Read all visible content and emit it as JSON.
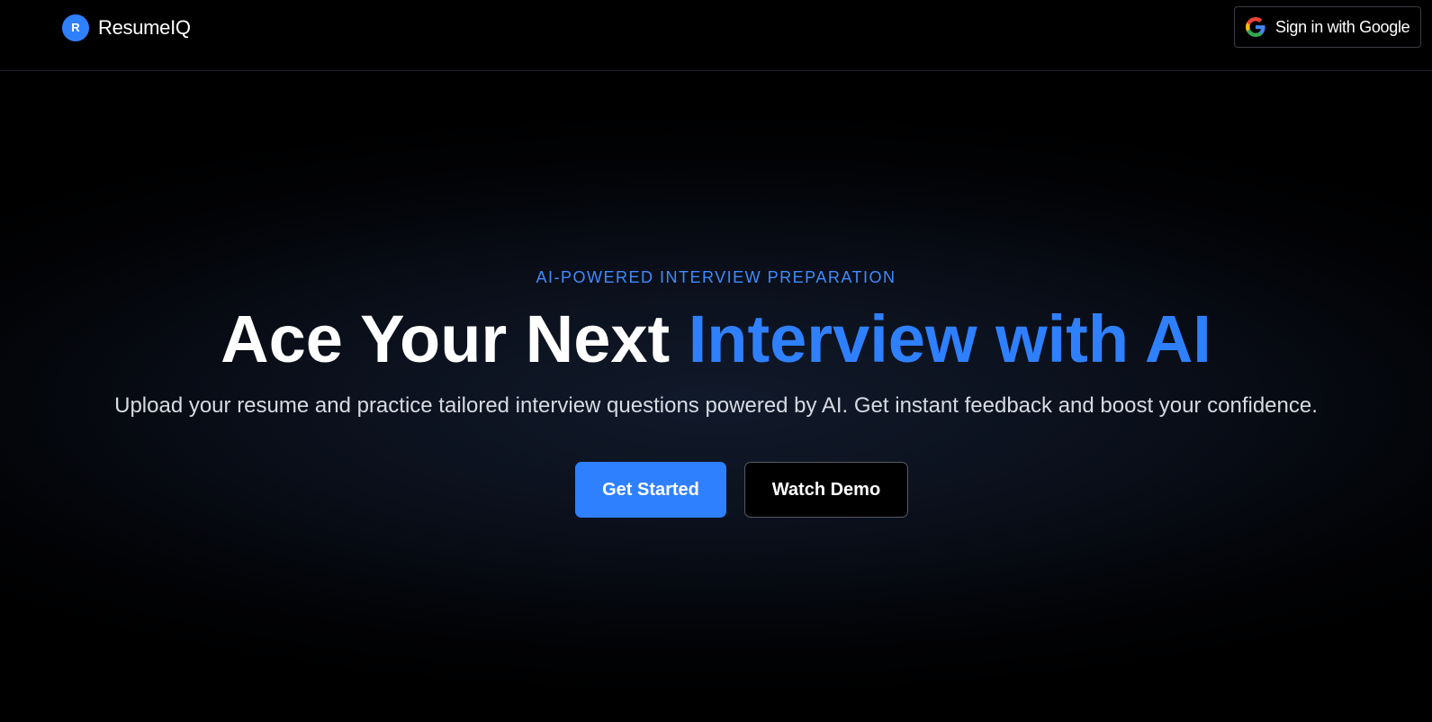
{
  "brand": {
    "mark": "R",
    "name": "ResumeIQ"
  },
  "header": {
    "sign_in_label": "Sign in with Google",
    "sign_in_icon": "google-icon"
  },
  "hero": {
    "eyebrow": "AI-POWERED INTERVIEW PREPARATION",
    "headline_white": "Ace Your Next",
    "headline_blue": "Interview with AI",
    "subline": "Upload your resume and practice tailored interview questions powered by AI. Get instant feedback and boost your confidence.",
    "primary_cta": "Get Started",
    "secondary_cta": "Watch Demo"
  },
  "colors": {
    "accent": "#2f80ff",
    "background": "#000000",
    "text": "#ffffff"
  }
}
